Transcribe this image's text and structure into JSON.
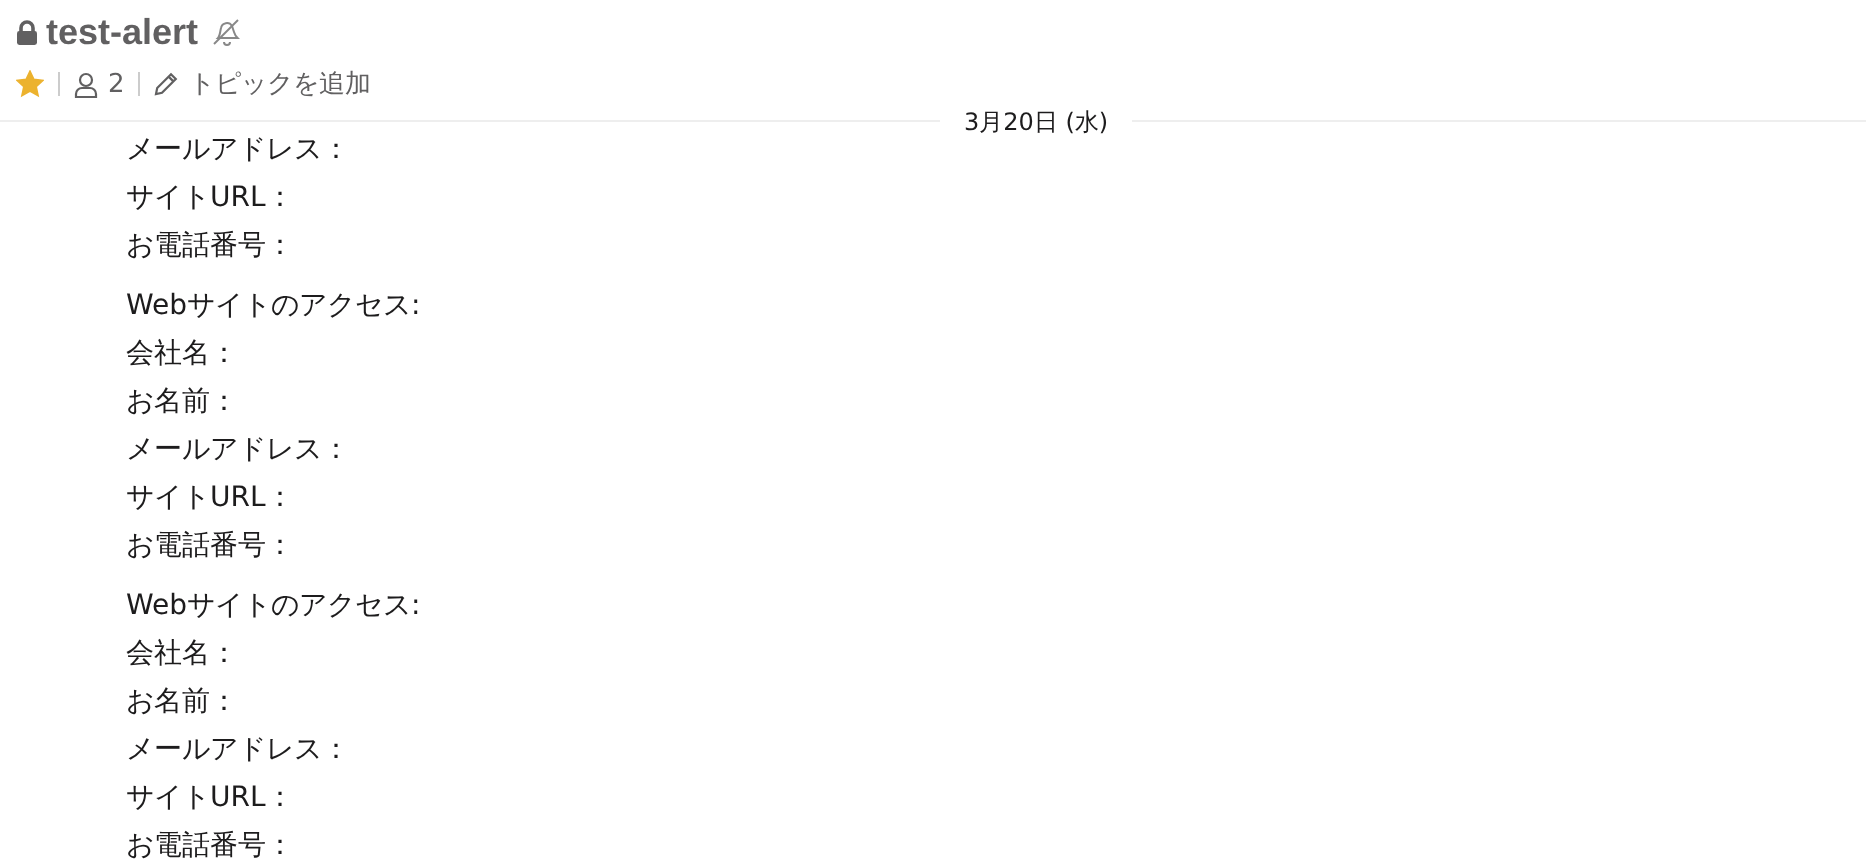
{
  "channel": {
    "name": "test-alert",
    "private": true,
    "muted": true,
    "starred": true,
    "member_count": "2",
    "topic_action": "トピックを追加"
  },
  "date_divider": "3月20日 (水)",
  "messages": [
    {
      "lines": [
        "メールアドレス：",
        "サイトURL：",
        "お電話番号："
      ]
    },
    {
      "lines": [
        "Webサイトのアクセス:",
        "会社名：",
        "お名前：",
        "メールアドレス：",
        "サイトURL：",
        "お電話番号："
      ]
    },
    {
      "lines": [
        "Webサイトのアクセス:",
        "会社名：",
        "お名前：",
        "メールアドレス：",
        "サイトURL：",
        "お電話番号："
      ]
    }
  ]
}
